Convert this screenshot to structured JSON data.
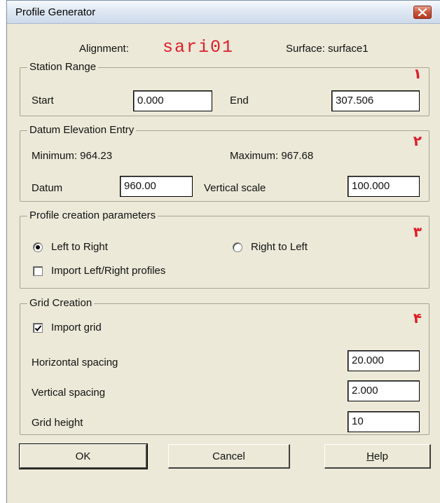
{
  "window": {
    "title": "Profile Generator"
  },
  "header": {
    "alignment_label": "Alignment:",
    "alignment_value": "sari01",
    "surface_text": "Surface: surface1"
  },
  "station_range": {
    "title": "Station Range",
    "marker": "١",
    "start_label": "Start",
    "start_value": "0.000",
    "end_label": "End",
    "end_value": "307.506"
  },
  "datum": {
    "title": "Datum Elevation Entry",
    "marker": "٢",
    "minimum_text": "Minimum: 964.23",
    "maximum_text": "Maximum: 967.68",
    "datum_label": "Datum",
    "datum_value": "960.00",
    "vscale_label": "Vertical scale",
    "vscale_value": "100.000"
  },
  "profile_params": {
    "title": "Profile creation parameters",
    "marker": "٣",
    "left_to_right_label": "Left to Right",
    "right_to_left_label": "Right to Left",
    "selected": "Left to Right",
    "import_lr_label": "Import Left/Right profiles",
    "import_lr_checked": false
  },
  "grid": {
    "title": "Grid Creation",
    "marker": "۴",
    "import_grid_label": "Import grid",
    "import_grid_checked": true,
    "hspacing_label": "Horizontal spacing",
    "hspacing_value": "20.000",
    "vspacing_label": "Vertical spacing",
    "vspacing_value": "2.000",
    "height_label": "Grid height",
    "height_value": "10"
  },
  "buttons": {
    "ok": "OK",
    "cancel": "Cancel",
    "help": "Help"
  },
  "colors": {
    "accent_red": "#e11d2a",
    "dialog_bg": "#ece9d8"
  }
}
